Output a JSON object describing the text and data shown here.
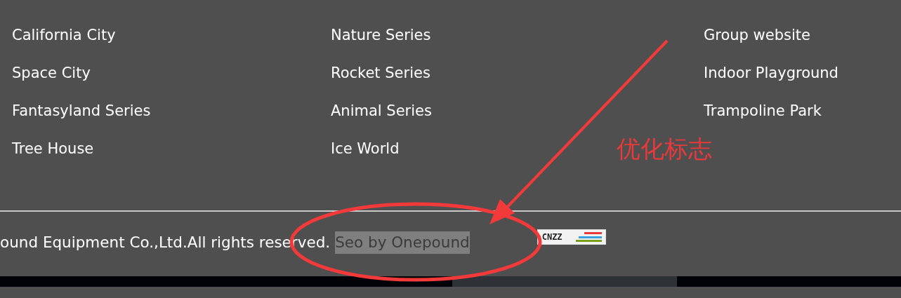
{
  "link_columns": [
    {
      "links": [
        "California City",
        "Space City",
        "Fantasyland Series",
        "Tree House"
      ]
    },
    {
      "links": [
        "Nature Series",
        "Rocket Series",
        "Animal Series",
        "Ice World"
      ]
    },
    {
      "links": [
        "Group website",
        "Indoor Playground",
        "Trampoline Park"
      ]
    }
  ],
  "copyright": "ound Equipment Co.,Ltd.All rights reserved.",
  "seo_credit": {
    "text": "Seo by Onepound",
    "selected": true
  },
  "stats_badge": {
    "text": "CNZZ"
  },
  "annotation": {
    "label": "优化标志"
  }
}
